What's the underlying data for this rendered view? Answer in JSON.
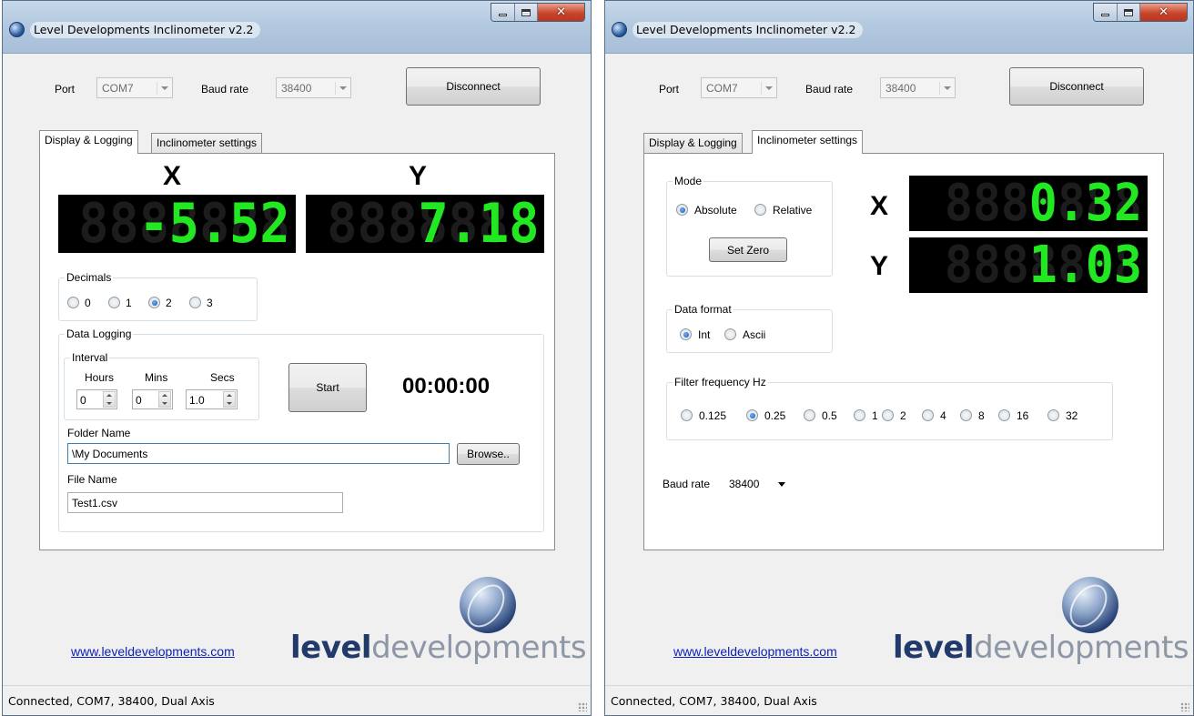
{
  "window_title": "Level Developments Inclinometer v2.2",
  "connection": {
    "port_label": "Port",
    "port_value": "COM7",
    "baud_label": "Baud rate",
    "baud_value": "38400",
    "disconnect_label": "Disconnect"
  },
  "tabs": [
    "Display & Logging",
    "Inclinometer settings"
  ],
  "display": {
    "x_label": "X",
    "y_label": "Y",
    "x_value": "-5.52",
    "y_value": "7.18",
    "decimals_title": "Decimals",
    "decimals_options": [
      "0",
      "1",
      "2",
      "3"
    ],
    "decimals_selected": "2"
  },
  "logging": {
    "title": "Data Logging",
    "interval_title": "Interval",
    "hours_label": "Hours",
    "mins_label": "Mins",
    "secs_label": "Secs",
    "hours_value": "0",
    "mins_value": "0",
    "secs_value": "1.0",
    "start_label": "Start",
    "timer": "00:00:00",
    "folder_label": "Folder Name",
    "folder_value": "\\My Documents",
    "browse_label": "Browse..",
    "file_label": "File Name",
    "file_value": "Test1.csv"
  },
  "settings": {
    "mode_title": "Mode",
    "mode_options": [
      "Absolute",
      "Relative"
    ],
    "mode_selected": "Absolute",
    "set_zero_label": "Set Zero",
    "x_label": "X",
    "y_label": "Y",
    "x_value": "0.32",
    "y_value": "1.03",
    "format_title": "Data format",
    "format_options": [
      "Int",
      "Ascii"
    ],
    "format_selected": "Int",
    "filter_title": "Filter frequency Hz",
    "filter_options": [
      "0.125",
      "0.25",
      "0.5",
      "1",
      "2",
      "4",
      "8",
      "16",
      "32"
    ],
    "filter_selected": "0.25",
    "baud_label": "Baud rate",
    "baud_value": "38400"
  },
  "footer": {
    "link": "www.leveldevelopments.com",
    "logo_word_1": "level",
    "logo_word_2": "developments"
  },
  "status": "Connected, COM7, 38400, Dual Axis",
  "icons": {
    "app": "app-icon",
    "minimize": "minimize-icon",
    "maximize": "maximize-icon",
    "close": "close-icon"
  },
  "colors": {
    "lcd_on": "#22e822",
    "lcd_background": "#000000",
    "link": "#0b1fb5",
    "close_button": "#c8452a"
  }
}
